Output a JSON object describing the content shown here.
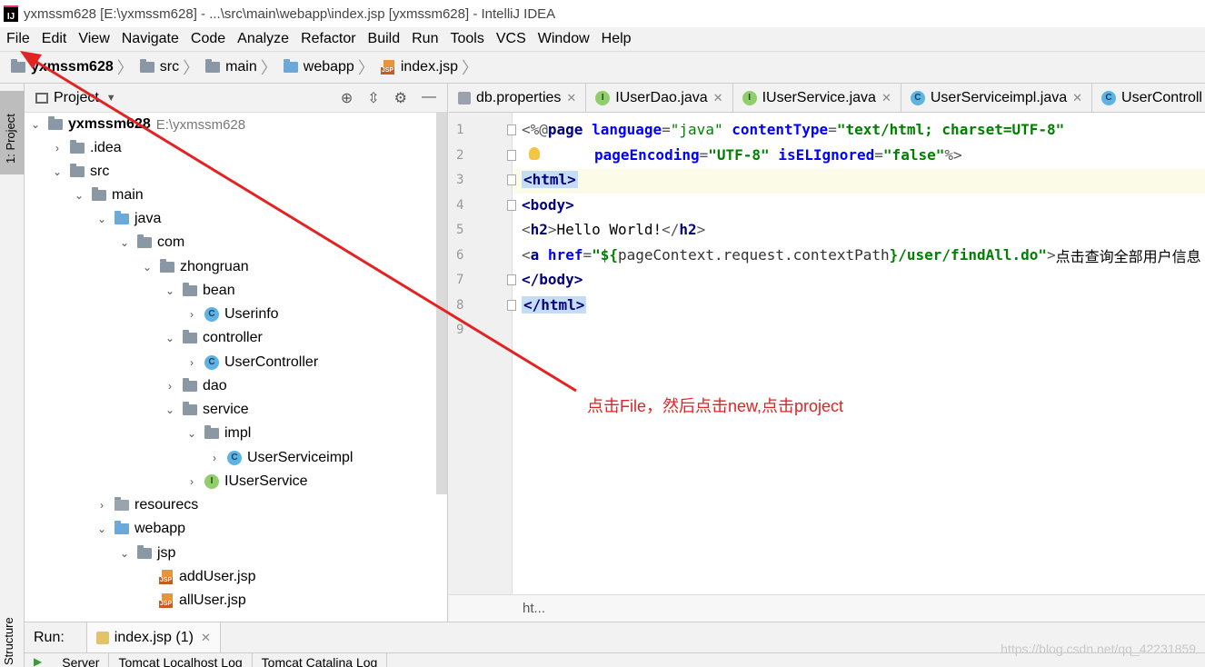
{
  "window": {
    "title": "yxmssm628 [E:\\yxmssm628] - ...\\src\\main\\webapp\\index.jsp [yxmssm628] - IntelliJ IDEA"
  },
  "menu": [
    "File",
    "Edit",
    "View",
    "Navigate",
    "Code",
    "Analyze",
    "Refactor",
    "Build",
    "Run",
    "Tools",
    "VCS",
    "Window",
    "Help"
  ],
  "breadcrumb": [
    "yxmssm628",
    "src",
    "main",
    "webapp",
    "index.jsp"
  ],
  "toolstrip": {
    "project": "1: Project",
    "structure": "Structure"
  },
  "project_panel": {
    "title": "Project"
  },
  "tree": [
    {
      "label": "yxmssm628",
      "path": "E:\\yxmssm628"
    },
    {
      "label": ".idea"
    },
    {
      "label": "src"
    },
    {
      "label": "main"
    },
    {
      "label": "java"
    },
    {
      "label": "com"
    },
    {
      "label": "zhongruan"
    },
    {
      "label": "bean"
    },
    {
      "label": "Userinfo"
    },
    {
      "label": "controller"
    },
    {
      "label": "UserController"
    },
    {
      "label": "dao"
    },
    {
      "label": "service"
    },
    {
      "label": "impl"
    },
    {
      "label": "UserServiceimpl"
    },
    {
      "label": "IUserService"
    },
    {
      "label": "resourecs"
    },
    {
      "label": "webapp"
    },
    {
      "label": "jsp"
    },
    {
      "label": "addUser.jsp"
    },
    {
      "label": "allUser.jsp"
    }
  ],
  "tabs": [
    "db.properties",
    "IUserDao.java",
    "IUserService.java",
    "UserServiceimpl.java",
    "UserControll"
  ],
  "tab_icon_letters": {
    "class": "C",
    "interface": "I"
  },
  "editor": {
    "line_numbers": [
      "1",
      "2",
      "3",
      "4",
      "5",
      "6",
      "7",
      "8",
      "9"
    ],
    "code": {
      "l1_open": "<%@ ",
      "l1_kw": "page",
      "l1_a1": "language",
      "l1_eq": "=",
      "l1_v1": "\"java\"",
      "l1_a2": "contentType",
      "l1_v2": "\"text/html; charset=UTF-8\"",
      "l2_a1": "pageEncoding",
      "l2_v1": "\"UTF-8\"",
      "l2_a2": "isELIgnored",
      "l2_v2": "\"false\"",
      "l2_close": "%>",
      "l3": "<html>",
      "l4": "<body>",
      "l5_lt": "<",
      "l5_tag": "h2",
      "l5_gt": ">",
      "l5_text": "Hello World!",
      "l5_close_lt": "</",
      "l5_close_gt": ">",
      "l6_lt": "<",
      "l6_tag": "a",
      "l6_attr": "href",
      "l6_eq": "=",
      "l6_q1": "\"${",
      "l6_expr": "pageContext.request.contextPath",
      "l6_q2": "}/user/findAll.do\"",
      "l6_gt": ">",
      "l6_text": "点击查询全部用户信息",
      "l7": "</body>",
      "l8": "</html>"
    },
    "footer": "ht..."
  },
  "run": {
    "label": "Run:",
    "tab": "index.jsp (1)",
    "subtabs": [
      "Server",
      "Tomcat Localhost Log",
      "Tomcat Catalina Log"
    ]
  },
  "annotation": {
    "text": "点击File，然后点击new,点击project",
    "color": "#e32222"
  },
  "watermark": "https://blog.csdn.net/qq_42231859"
}
